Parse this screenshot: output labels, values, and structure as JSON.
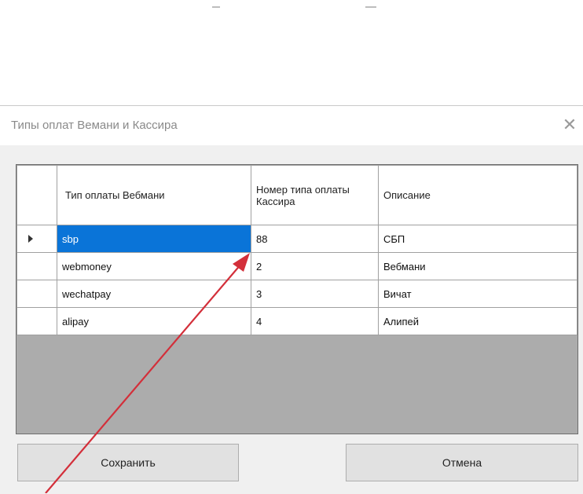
{
  "dialog": {
    "title": "Типы оплат Вемани и Кассира",
    "close_symbol": "✕"
  },
  "grid": {
    "columns": [
      "Тип оплаты Вебмани",
      "Номер типа оплаты Кассира",
      "Описание"
    ],
    "rows": [
      {
        "type": "sbp",
        "number": "88",
        "description": "СБП",
        "selected": true
      },
      {
        "type": "webmoney",
        "number": "2",
        "description": "Вебмани",
        "selected": false
      },
      {
        "type": "wechatpay",
        "number": "3",
        "description": "Вичат",
        "selected": false
      },
      {
        "type": "alipay",
        "number": "4",
        "description": "Алипей",
        "selected": false
      }
    ]
  },
  "buttons": {
    "save_label": "Сохранить",
    "cancel_label": "Отмена"
  },
  "annotation": {
    "arrow_color": "#d32f3a"
  },
  "colors": {
    "selection": "#0a74d8",
    "dialog_bg": "#f0f0f0",
    "grid_empty_bg": "#acacac"
  }
}
